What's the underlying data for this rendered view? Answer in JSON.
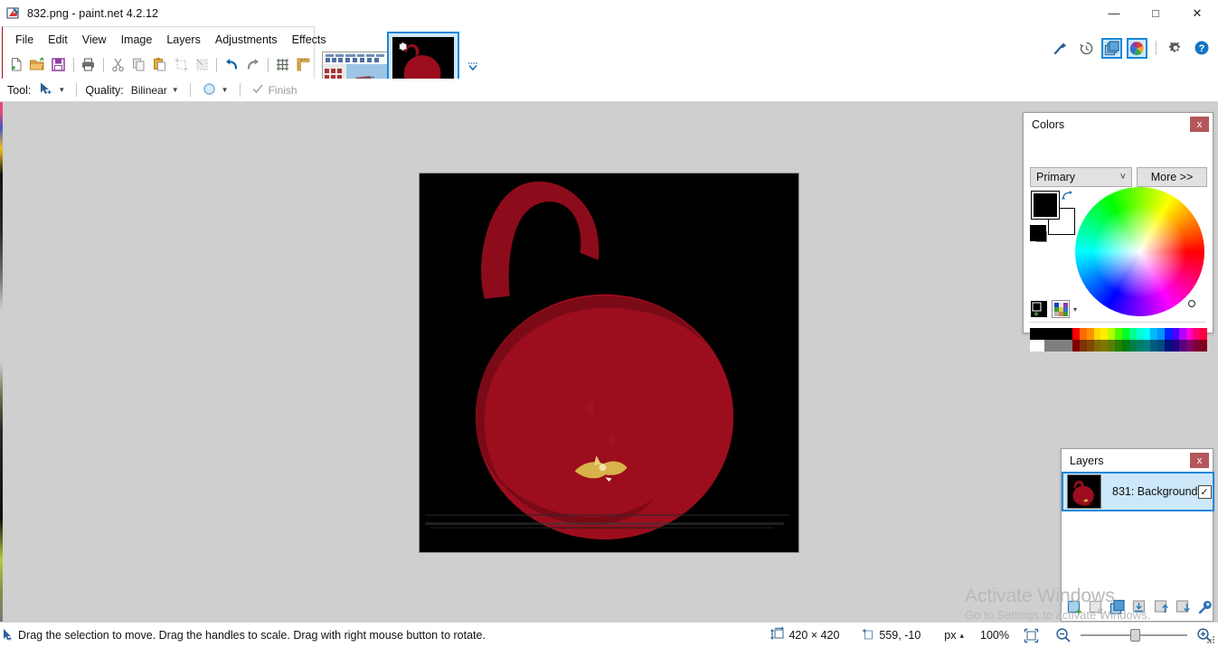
{
  "window": {
    "title": "832.png - paint.net 4.2.12",
    "app_icon": "paintnet-icon",
    "minimize": "—",
    "maximize": "□",
    "close": "✕"
  },
  "menu": {
    "items": [
      {
        "label": "File"
      },
      {
        "label": "Edit"
      },
      {
        "label": "View"
      },
      {
        "label": "Image"
      },
      {
        "label": "Layers"
      },
      {
        "label": "Adjustments"
      },
      {
        "label": "Effects"
      }
    ]
  },
  "toolbar": {
    "buttons": [
      {
        "name": "new-icon",
        "tip": "New"
      },
      {
        "name": "open-icon",
        "tip": "Open"
      },
      {
        "name": "save-icon",
        "tip": "Save"
      },
      {
        "name": "print-icon",
        "tip": "Print"
      },
      {
        "name": "cut-icon",
        "tip": "Cut"
      },
      {
        "name": "copy-icon",
        "tip": "Copy"
      },
      {
        "name": "paste-icon",
        "tip": "Paste"
      },
      {
        "name": "crop-icon",
        "tip": "Crop to Selection"
      },
      {
        "name": "deselect-icon",
        "tip": "Deselect All"
      },
      {
        "name": "undo-icon",
        "tip": "Undo"
      },
      {
        "name": "redo-icon",
        "tip": "Redo"
      },
      {
        "name": "grid-icon",
        "tip": "Show Pixel Grid"
      },
      {
        "name": "rulers-icon",
        "tip": "Show Rulers"
      }
    ]
  },
  "tabs": {
    "chevron": "chevron-down-icon",
    "items": [
      {
        "name": "tab-thumbnail-1",
        "selected": false
      },
      {
        "name": "tab-thumbnail-2",
        "selected": true
      }
    ]
  },
  "options": {
    "tool_label": "Tool:",
    "tool_icon": "move-selection-icon",
    "quality_label": "Quality:",
    "quality_value": "Bilinear",
    "sampling_icon": "sampling-icon",
    "finish_label": "Finish",
    "finish_icon": "check-icon"
  },
  "right_toolbar": {
    "buttons": [
      {
        "name": "tools-icon",
        "label": "Tools",
        "active": false
      },
      {
        "name": "history-icon",
        "label": "History",
        "active": false
      },
      {
        "name": "layers-icon",
        "label": "Layers",
        "active": true
      },
      {
        "name": "colors-icon",
        "label": "Colors",
        "active": true
      },
      {
        "name": "settings-icon",
        "label": "Settings",
        "active": false
      },
      {
        "name": "help-icon",
        "label": "Help",
        "active": false
      }
    ]
  },
  "colors_window": {
    "title": "Colors",
    "close": "x",
    "mode_value": "Primary",
    "mode_caret": "⌄",
    "more_label": "More >>",
    "primary_color": "#000000",
    "secondary_color": "#ffffff",
    "swap_icon": "swap-colors-icon",
    "picker_icon": "color-picker-icon",
    "palette_icon": "palette-icon",
    "palette_caret": "▾",
    "palette_row1": [
      "#000000",
      "#000000",
      "#000000",
      "#000000",
      "#000000",
      "#000000",
      "#ff0000",
      "#ff6a00",
      "#ff9100",
      "#ffd800",
      "#ffee00",
      "#b6ff00",
      "#4cff00",
      "#00ff21",
      "#00ff90",
      "#00ffd5",
      "#00ffff",
      "#00b7ff",
      "#0094ff",
      "#0026ff",
      "#4800ff",
      "#b200ff",
      "#ff00dc",
      "#ff006e",
      "#ff0040"
    ],
    "palette_row2": [
      "#ffffff",
      "#ffffff",
      "#7f7f7f",
      "#7f7f7f",
      "#7f7f7f",
      "#7f7f7f",
      "#7f0000",
      "#7f3300",
      "#7f4800",
      "#7f6a00",
      "#7f7600",
      "#5b7f00",
      "#267f00",
      "#007f0e",
      "#007f46",
      "#007f66",
      "#007f7f",
      "#005b7f",
      "#004a7f",
      "#00137f",
      "#21007f",
      "#57007f",
      "#7f006e",
      "#7f0037",
      "#7f0020"
    ]
  },
  "layers_window": {
    "title": "Layers",
    "close": "x",
    "layers": [
      {
        "name": "831: Background",
        "visible": true,
        "checkmark": "✓",
        "selected": true
      }
    ],
    "toolbar": [
      {
        "name": "add-layer-icon",
        "label": "Add New Layer"
      },
      {
        "name": "delete-layer-icon",
        "label": "Delete Layer"
      },
      {
        "name": "duplicate-layer-icon",
        "label": "Duplicate Layer"
      },
      {
        "name": "merge-layer-down-icon",
        "label": "Merge Layer Down"
      },
      {
        "name": "move-layer-up-icon",
        "label": "Move Layer Up"
      },
      {
        "name": "move-layer-down-icon",
        "label": "Move Layer Down"
      },
      {
        "name": "layer-properties-icon",
        "label": "Layer Properties"
      }
    ]
  },
  "canvas": {
    "background": "#000000",
    "ornament_color": "#9c0d1e",
    "ornament_shade": "#7c0a18",
    "accent_color": "#d8b24a"
  },
  "watermark": {
    "line1": "Activate Windows",
    "line2": "Go to Settings to activate Windows."
  },
  "statusbar": {
    "cursor_icon": "move-selection-cursor-icon",
    "message": "Drag the selection to move. Drag the handles to scale. Drag with right mouse button to rotate.",
    "size_icon": "image-size-icon",
    "size_value": "420 × 420",
    "position_icon": "cursor-position-icon",
    "position_value": "559, -10",
    "units_value": "px",
    "units_caret": "▴",
    "zoom_value": "100%",
    "fit_icon": "fit-to-window-icon",
    "zoom_out_icon": "zoom-out-icon",
    "zoom_in_icon": "zoom-in-icon",
    "grip_icon": "resize-grip-icon"
  }
}
